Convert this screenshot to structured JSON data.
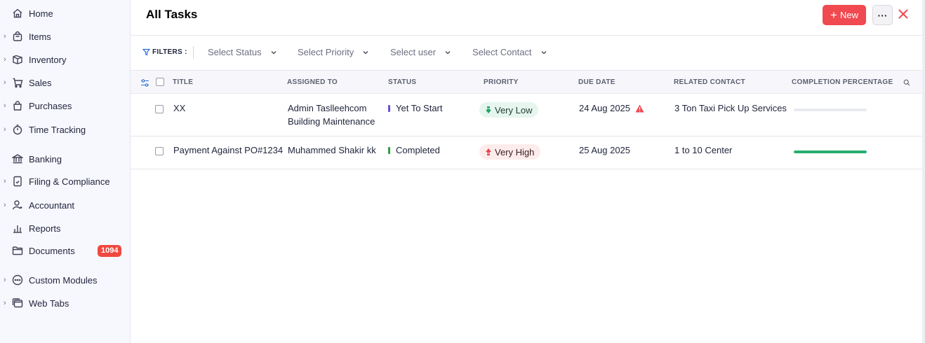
{
  "sidebar": {
    "items": [
      {
        "label": "Home",
        "icon": "home-icon"
      },
      {
        "label": "Items",
        "icon": "shopping-bag-icon"
      },
      {
        "label": "Inventory",
        "icon": "box-icon"
      },
      {
        "label": "Sales",
        "icon": "cart-icon"
      },
      {
        "label": "Purchases",
        "icon": "bag-icon"
      },
      {
        "label": "Time Tracking",
        "icon": "stopwatch-icon"
      },
      {
        "label": "Banking",
        "icon": "bank-icon"
      },
      {
        "label": "Filing & Compliance",
        "icon": "document-icon"
      },
      {
        "label": "Accountant",
        "icon": "user-icon"
      },
      {
        "label": "Reports",
        "icon": "bar-chart-icon"
      },
      {
        "label": "Documents",
        "icon": "folder-icon",
        "badge": "1094"
      },
      {
        "label": "Custom Modules",
        "icon": "modules-icon"
      },
      {
        "label": "Web Tabs",
        "icon": "web-tabs-icon"
      }
    ]
  },
  "header": {
    "title": "All Tasks",
    "new_label": "New",
    "more_label": "···",
    "accent": "#f04950"
  },
  "filters": {
    "label": "FILTERS :",
    "selects": [
      "Select Status",
      "Select Priority",
      "Select user",
      "Select Contact"
    ]
  },
  "table": {
    "columns": [
      "TITLE",
      "ASSIGNED TO",
      "STATUS",
      "PRIORITY",
      "DUE DATE",
      "RELATED CONTACT",
      "COMPLETION PERCENTAGE"
    ],
    "rows": [
      {
        "title": "XX",
        "assigned_to": [
          "Admin Taslleehcom",
          "Building Maintenance"
        ],
        "status": "Yet To Start",
        "status_color": "#6a4fd6",
        "priority": "Very Low",
        "priority_color": "#1fa463",
        "due_date": "24 Aug 2025",
        "due_warning": true,
        "related_contact": "3 Ton Taxi Pick Up Services",
        "completion": 0
      },
      {
        "title": "Payment Against PO#1234",
        "assigned_to": [
          "Muhammed Shakir kk"
        ],
        "status": "Completed",
        "status_color": "#2f9e44",
        "priority": "Very High",
        "priority_color": "#e5484d",
        "due_date": "25 Aug 2025",
        "due_warning": false,
        "related_contact": "1 to 10 Center",
        "completion": 100
      }
    ]
  }
}
